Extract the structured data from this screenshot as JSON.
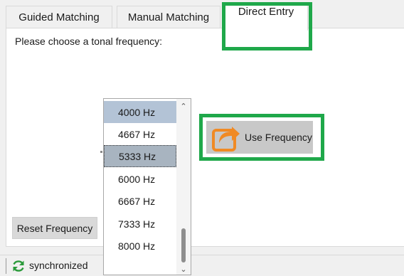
{
  "tabs": [
    {
      "label": "Guided Matching"
    },
    {
      "label": "Manual Matching"
    },
    {
      "label": "Direct Entry",
      "active": true
    }
  ],
  "panel": {
    "prompt": "Please choose a tonal frequency:"
  },
  "frequency_dropdown": {
    "items": [
      "4000 Hz",
      "4667 Hz",
      "5333 Hz",
      "6000 Hz",
      "6667 Hz",
      "7333 Hz",
      "8000 Hz"
    ],
    "selected_value": "5333 Hz"
  },
  "buttons": {
    "use_frequency": "Use Frequency",
    "reset_frequency": "Reset Frequency"
  },
  "status_bar": {
    "sync_status": "synchronized"
  },
  "colors": {
    "highlight": "#1fa84a",
    "icon_orange": "#f08a24",
    "sync_green": "#2a9a3a"
  }
}
